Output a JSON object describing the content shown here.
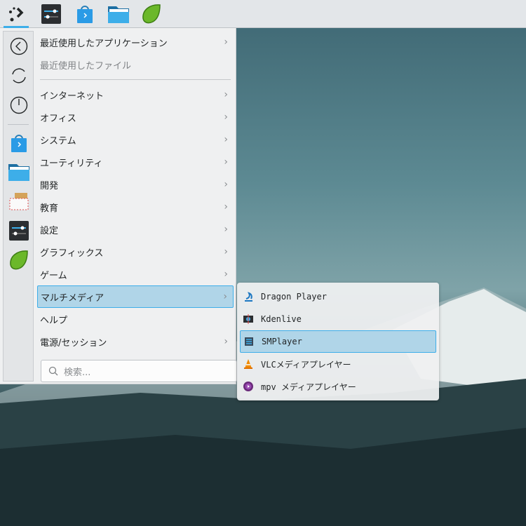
{
  "taskbar": {
    "items": [
      {
        "name": "application-launcher"
      },
      {
        "name": "system-settings"
      },
      {
        "name": "discover"
      },
      {
        "name": "file-manager"
      },
      {
        "name": "meteo"
      }
    ]
  },
  "sidebar": {
    "items": [
      "back-icon",
      "refresh-icon",
      "power-icon",
      "discover-icon",
      "folder-icon",
      "mail-icon",
      "settings-icon",
      "leaf-icon"
    ]
  },
  "menu": {
    "recent_apps": "最近使用したアプリケーション",
    "recent_files": "最近使用したファイル",
    "categories": [
      "インターネット",
      "オフィス",
      "システム",
      "ユーティリティ",
      "開発",
      "教育",
      "設定",
      "グラフィックス",
      "ゲーム",
      "マルチメディア",
      "ヘルプ",
      "電源/セッション"
    ],
    "search_placeholder": "検索..."
  },
  "submenu": {
    "items": [
      "Dragon Player",
      "Kdenlive",
      "SMPlayer",
      "VLCメディアプレイヤー",
      "mpv メディアプレイヤー"
    ],
    "selected": "SMPlayer"
  },
  "colors": {
    "accent": "#3daee9",
    "selection": "#b0d5e8"
  }
}
